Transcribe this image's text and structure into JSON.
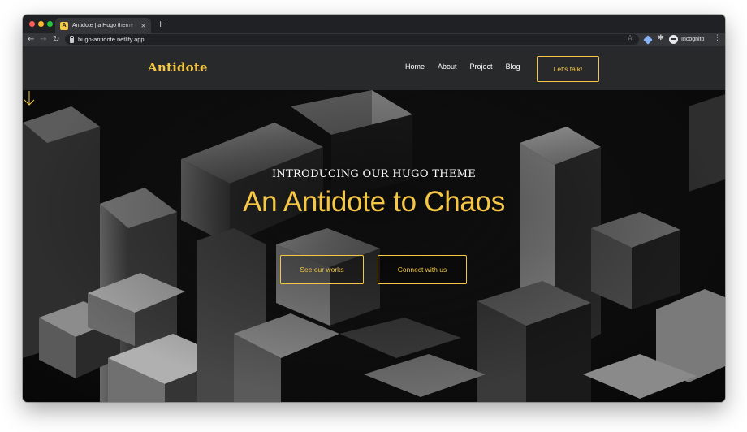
{
  "browser": {
    "tab_title": "Antidote | a Hugo theme crafted",
    "tab_favicon": "A",
    "tab_close": "×",
    "new_tab": "+",
    "url": "hugo-antidote.netlify.app",
    "back": "←",
    "forward": "→",
    "reload": "↻",
    "star": "☆",
    "puzzle": "✱",
    "menu": "⋮",
    "profile_label": "Incognito"
  },
  "site": {
    "logo": "Antidote",
    "nav": [
      {
        "label": "Home"
      },
      {
        "label": "About"
      },
      {
        "label": "Project"
      },
      {
        "label": "Blog"
      }
    ],
    "cta_label": "Let's talk!",
    "accent_color": "#f6c744"
  },
  "hero": {
    "eyebrow": "INTRODUCING OUR HUGO THEME",
    "headline": "An Antidote to Chaos",
    "buttons": [
      {
        "label": "See our works"
      },
      {
        "label": "Connect with us"
      }
    ],
    "scroll_icon": "arrow-down-icon"
  }
}
